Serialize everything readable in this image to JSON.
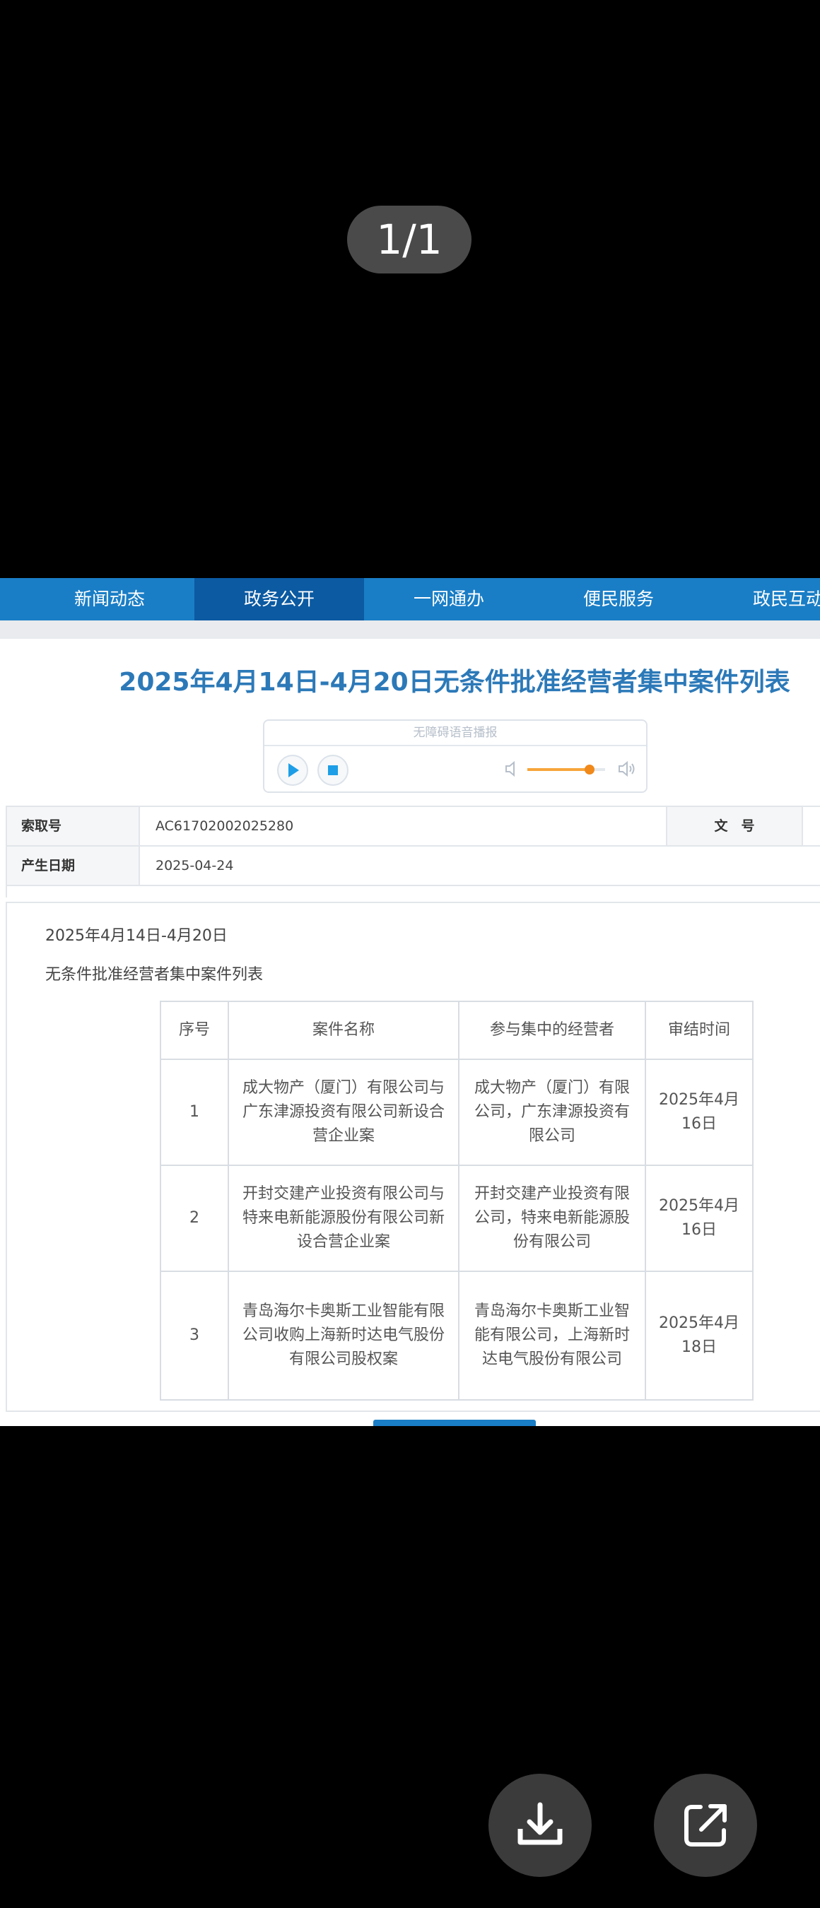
{
  "viewer": {
    "page_counter": "1/1"
  },
  "nav": {
    "items": [
      {
        "label": "新闻动态",
        "active": false
      },
      {
        "label": "政务公开",
        "active": true
      },
      {
        "label": "一网通办",
        "active": false
      },
      {
        "label": "便民服务",
        "active": false
      },
      {
        "label": "政民互动",
        "active": false
      }
    ]
  },
  "article": {
    "title": "2025年4月14日-4月20日无条件批准经营者集中案件列表"
  },
  "audio": {
    "label": "无障碍语音播报",
    "volume": 0.8
  },
  "meta": {
    "index_label": "索取号",
    "index_value": "AC61702002025280",
    "doc_no_label": "文　号",
    "date_label": "产生日期",
    "date_value": "2025-04-24"
  },
  "content": {
    "line1": "2025年4月14日-4月20日",
    "line2": "无条件批准经营者集中案件列表"
  },
  "table": {
    "headers": [
      "序号",
      "案件名称",
      "参与集中的经营者",
      "审结时间"
    ],
    "rows": [
      {
        "no": "1",
        "name": "成大物产（厦门）有限公司与广东津源投资有限公司新设合营企业案",
        "parties": "成大物产（厦门）有限公司，广东津源投资有限公司",
        "date": "2025年4月16日"
      },
      {
        "no": "2",
        "name": "开封交建产业投资有限公司与特来电新能源股份有限公司新设合营企业案",
        "parties": "开封交建产业投资有限公司，特来电新能源股份有限公司",
        "date": "2025年4月16日"
      },
      {
        "no": "3",
        "name": "青岛海尔卡奥斯工业智能有限公司收购上海新时达电气股份有限公司股权案",
        "parties": "青岛海尔卡奥斯工业智能有限公司，上海新时达电气股份有限公司",
        "date": "2025年4月18日"
      }
    ]
  },
  "actions": {
    "download_icon": "download-icon",
    "share_icon": "share-icon"
  }
}
